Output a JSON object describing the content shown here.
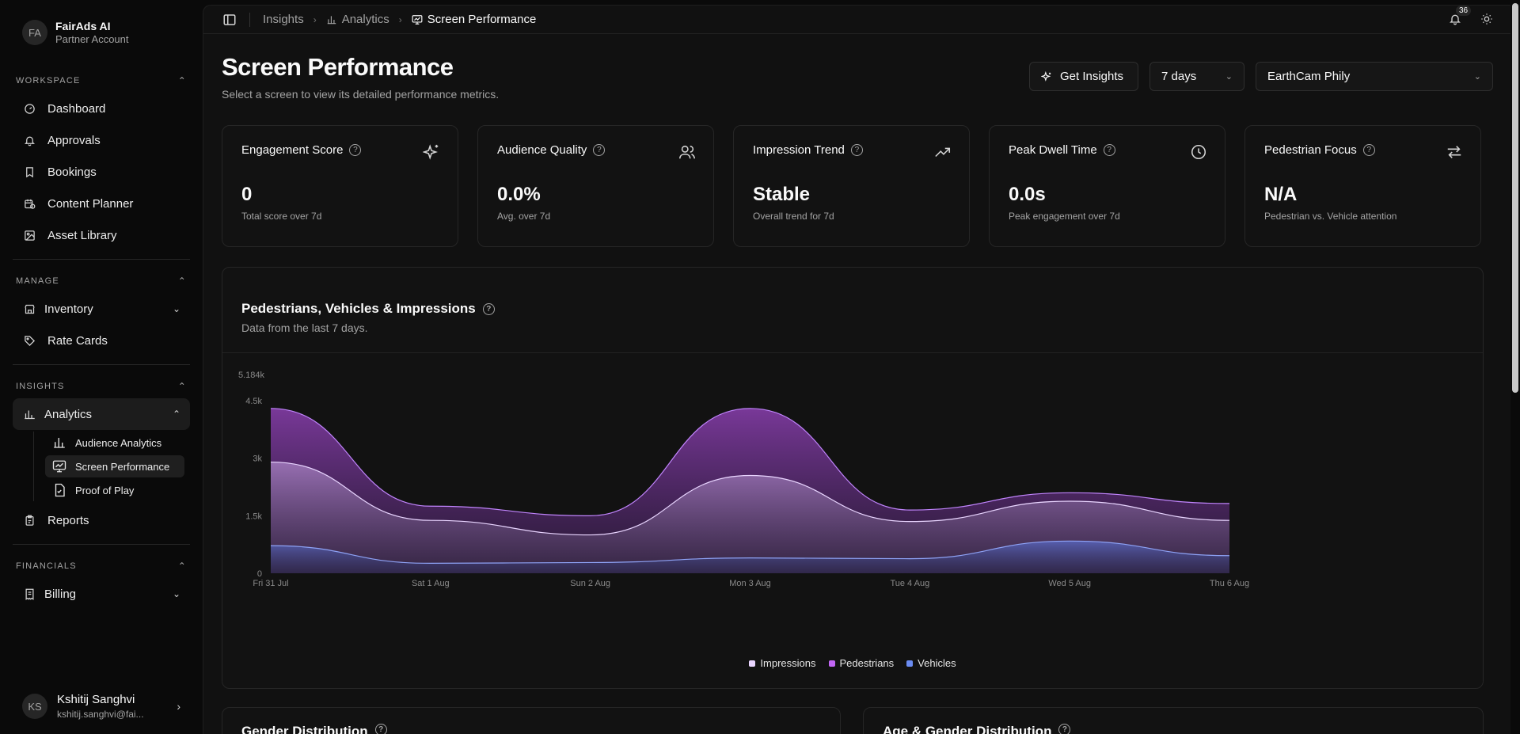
{
  "account": {
    "initials": "FA",
    "name": "FairAds AI",
    "type": "Partner Account"
  },
  "sidebar": {
    "workspace": {
      "title": "WORKSPACE",
      "items": [
        {
          "label": "Dashboard",
          "icon": "gauge-icon"
        },
        {
          "label": "Approvals",
          "icon": "bell-icon"
        },
        {
          "label": "Bookings",
          "icon": "bookmark-icon"
        },
        {
          "label": "Content Planner",
          "icon": "calendar-clock-icon"
        },
        {
          "label": "Asset Library",
          "icon": "image-icon"
        }
      ]
    },
    "manage": {
      "title": "MANAGE",
      "items": [
        {
          "label": "Inventory",
          "icon": "store-icon"
        },
        {
          "label": "Rate Cards",
          "icon": "tag-icon"
        }
      ]
    },
    "insights": {
      "title": "INSIGHTS",
      "analytics": "Analytics",
      "sub": [
        "Audience Analytics",
        "Screen Performance",
        "Proof of Play"
      ],
      "reports": "Reports"
    },
    "financials": {
      "title": "FINANCIALS",
      "billing": "Billing"
    }
  },
  "user": {
    "initials": "KS",
    "name": "Kshitij Sanghvi",
    "email": "kshitij.sanghvi@fai..."
  },
  "breadcrumb": [
    "Insights",
    "Analytics",
    "Screen Performance"
  ],
  "notifications": {
    "count": "36"
  },
  "page": {
    "title": "Screen Performance",
    "subtitle": "Select a screen to view its detailed performance metrics."
  },
  "controls": {
    "insights_label": "Get Insights",
    "period": "7 days",
    "screen": "EarthCam Phily"
  },
  "kpis": [
    {
      "title": "Engagement Score",
      "value": "0",
      "desc": "Total score over 7d",
      "icon": "sparkles-icon"
    },
    {
      "title": "Audience Quality",
      "value": "0.0%",
      "desc": "Avg. over 7d",
      "icon": "users-icon"
    },
    {
      "title": "Impression Trend",
      "value": "Stable",
      "desc": "Overall trend for 7d",
      "icon": "trending-up-icon"
    },
    {
      "title": "Peak Dwell Time",
      "value": "0.0s",
      "desc": "Peak engagement over 7d",
      "icon": "clock-icon"
    },
    {
      "title": "Pedestrian Focus",
      "value": "N/A",
      "desc": "Pedestrian vs. Vehicle attention",
      "icon": "arrows-swap-icon"
    }
  ],
  "chart": {
    "title": "Pedestrians, Vehicles & Impressions",
    "subtitle": "Data from the last 7 days."
  },
  "chart_data": {
    "type": "area",
    "x": [
      "Fri 31 Jul",
      "Sat 1 Aug",
      "Sun 2 Aug",
      "Mon 3 Aug",
      "Tue 4 Aug",
      "Wed 5 Aug",
      "Thu 6 Aug"
    ],
    "yticks": [
      "0",
      "1.5k",
      "3k",
      "4.5k",
      "5.184k"
    ],
    "ylim": [
      0,
      5184
    ],
    "series": [
      {
        "name": "Pedestrians",
        "color": "#a855f7",
        "values": [
          4300,
          1750,
          1500,
          4300,
          1650,
          2100,
          1820
        ]
      },
      {
        "name": "Impressions",
        "color": "#e9d5ff",
        "values": [
          2900,
          1380,
          1000,
          2550,
          1350,
          1880,
          1380
        ]
      },
      {
        "name": "Vehicles",
        "color": "#6b7fe0",
        "values": [
          720,
          260,
          280,
          400,
          380,
          840,
          460
        ]
      }
    ],
    "legend": [
      "Impressions",
      "Pedestrians",
      "Vehicles"
    ],
    "legend_colors": [
      "#e9d5ff",
      "#c266f5",
      "#6b8cf2"
    ]
  },
  "bottom": {
    "left_title": "Gender Distribution",
    "right_title": "Age & Gender Distribution"
  }
}
